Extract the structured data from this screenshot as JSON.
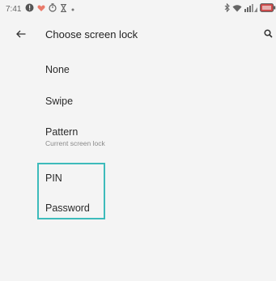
{
  "status_bar": {
    "time": "7:41",
    "left_icons": [
      "alert-circle-icon",
      "heart-icon",
      "timer-icon",
      "hourglass-icon",
      "dot-icon"
    ],
    "right_icons": [
      "bluetooth-icon",
      "wifi-icon",
      "signal-icon",
      "battery-icon"
    ]
  },
  "app_bar": {
    "title": "Choose screen lock",
    "back_icon": "arrow-back-icon",
    "search_icon": "search-icon"
  },
  "options": [
    {
      "label": "None"
    },
    {
      "label": "Swipe"
    },
    {
      "label": "Pattern",
      "subtitle": "Current screen lock"
    },
    {
      "label": "PIN"
    },
    {
      "label": "Password"
    }
  ],
  "colors": {
    "background": "#f4f4f4",
    "highlight": "#3dbbbb",
    "text_primary": "#2a2a2a",
    "text_secondary": "#8a8a8a"
  }
}
